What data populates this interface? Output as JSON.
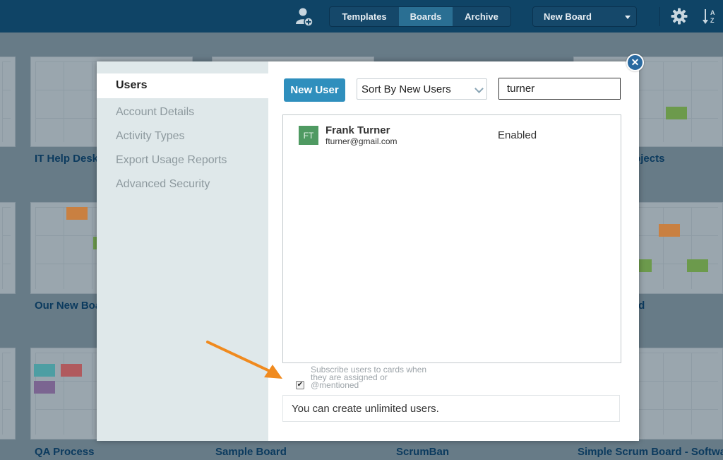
{
  "toolbar": {
    "tabs": [
      "Templates",
      "Boards",
      "Archive"
    ],
    "active_tab": "Boards",
    "new_board_label": "New Board"
  },
  "boards": {
    "titles": [
      "IT Help Desk",
      "Team Projects",
      "Our New Board",
      "Board",
      "QA Process",
      "Sample Board",
      "ScrumBan",
      "Simple Scrum Board - Software"
    ]
  },
  "modal": {
    "sidebar": {
      "active": "Users",
      "items": [
        "Account Details",
        "Activity Types",
        "Export Usage Reports",
        "Advanced Security"
      ]
    },
    "new_user_label": "New User",
    "sort_value": "Sort By New Users",
    "search_value": "turner",
    "users": [
      {
        "initials": "FT",
        "name": "Frank Turner",
        "email": "fturner@gmail.com",
        "status": "Enabled"
      }
    ],
    "subscribe_label": "Subscribe users to cards when they are assigned or @mentioned",
    "subscribe_checked": true,
    "info_text": "You can create unlimited users."
  },
  "colors": {
    "header": "#0f4466",
    "accent": "#2f8fbd",
    "avatar": "#4f9a62",
    "annotation_arrow": "#f08a1e"
  }
}
